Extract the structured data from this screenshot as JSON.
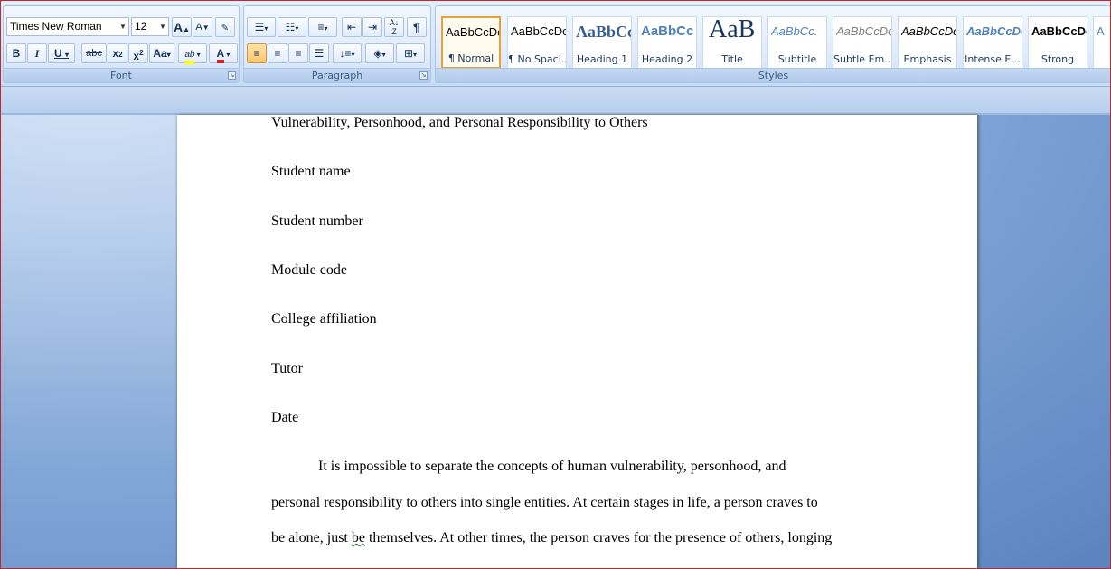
{
  "font_group": {
    "label": "Font",
    "font_name": "Times New Roman",
    "font_size": "12",
    "grow_font": "A",
    "shrink_font": "A",
    "bold": "B",
    "italic": "I",
    "underline": "U",
    "strikethrough": "abc",
    "subscript": "x",
    "superscript": "x",
    "change_case": "Aa",
    "highlight": "ab",
    "font_color": "A"
  },
  "paragraph_group": {
    "label": "Paragraph",
    "show_marks": "¶"
  },
  "styles_group": {
    "label": "Styles",
    "tiles": [
      {
        "sample": "AaBbCcDc",
        "name": "¶ Normal"
      },
      {
        "sample": "AaBbCcDc",
        "name": "¶ No Spaci..."
      },
      {
        "sample": "AaBbCc",
        "name": "Heading 1"
      },
      {
        "sample": "AaBbCc",
        "name": "Heading 2"
      },
      {
        "sample": "AaB",
        "name": "Title"
      },
      {
        "sample": "AaBbCc.",
        "name": "Subtitle"
      },
      {
        "sample": "AaBbCcDc",
        "name": "Subtle Em..."
      },
      {
        "sample": "AaBbCcDc",
        "name": "Emphasis"
      },
      {
        "sample": "AaBbCcDc",
        "name": "Intense E..."
      },
      {
        "sample": "AaBbCcDc",
        "name": "Strong"
      },
      {
        "sample": "A",
        "name": ""
      }
    ]
  },
  "document": {
    "title_line": "Vulnerability, Personhood, and Personal Responsibility to Others",
    "student_name": "Student name",
    "student_number": "Student number",
    "module_code": "Module code",
    "college": "College affiliation",
    "tutor": "Tutor",
    "date": "Date",
    "body_line1": "It is impossible to separate the concepts of human vulnerability, personhood, and",
    "body_line2": "personal responsibility to others into single entities. At certain stages in life, a person craves to",
    "body_line3a": "be alone, just ",
    "body_line3b": "be",
    "body_line3c": " themselves. At other times,  the person craves for the presence of others, longing"
  },
  "colors": {
    "highlight": "#ffff00",
    "font_color": "#e01b1b",
    "selected_tile": "#e5a23b"
  }
}
